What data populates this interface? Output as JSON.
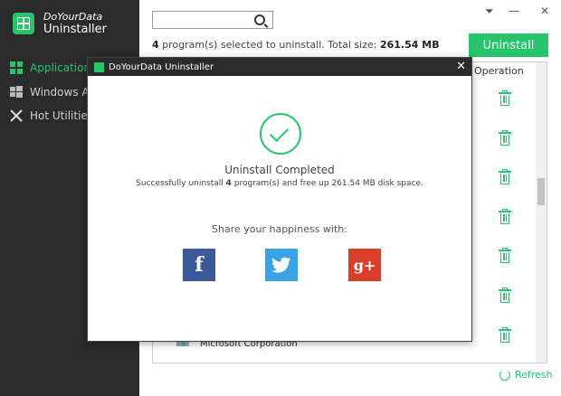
{
  "app": {
    "brand_top": "DoYourData",
    "brand_bottom": "Uninstaller"
  },
  "sidebar": {
    "items": [
      {
        "label": "Applications",
        "icon": "grid-icon",
        "active": true
      },
      {
        "label": "Windows Ap",
        "icon": "windows-icon",
        "active": false
      },
      {
        "label": "Hot Utilities",
        "icon": "tools-icon",
        "active": false
      }
    ]
  },
  "main": {
    "search": {
      "value": "",
      "placeholder": ""
    },
    "summary": {
      "count": "4",
      "middle": " program(s) selected to uninstall. Total size: ",
      "size": "261.54 MB"
    },
    "uninstall_label": "Uninstall",
    "list_header": "Operation",
    "visible_vendor": "Microsoft Corporation",
    "refresh_label": "Refresh"
  },
  "dialog": {
    "title": "DoYourData Uninstaller",
    "close": "✕",
    "heading": "Uninstall Completed",
    "msg_pre": "Successfully uninstall ",
    "msg_count": "4",
    "msg_post": " program(s) and free up 261.54 MB disk space.",
    "share_text": "Share your happiness with:",
    "facebook": "f",
    "twitter": "🐦",
    "googleplus": "g+"
  },
  "colors": {
    "accent": "#27c46b",
    "sidebar_bg": "#2b2b2b"
  }
}
